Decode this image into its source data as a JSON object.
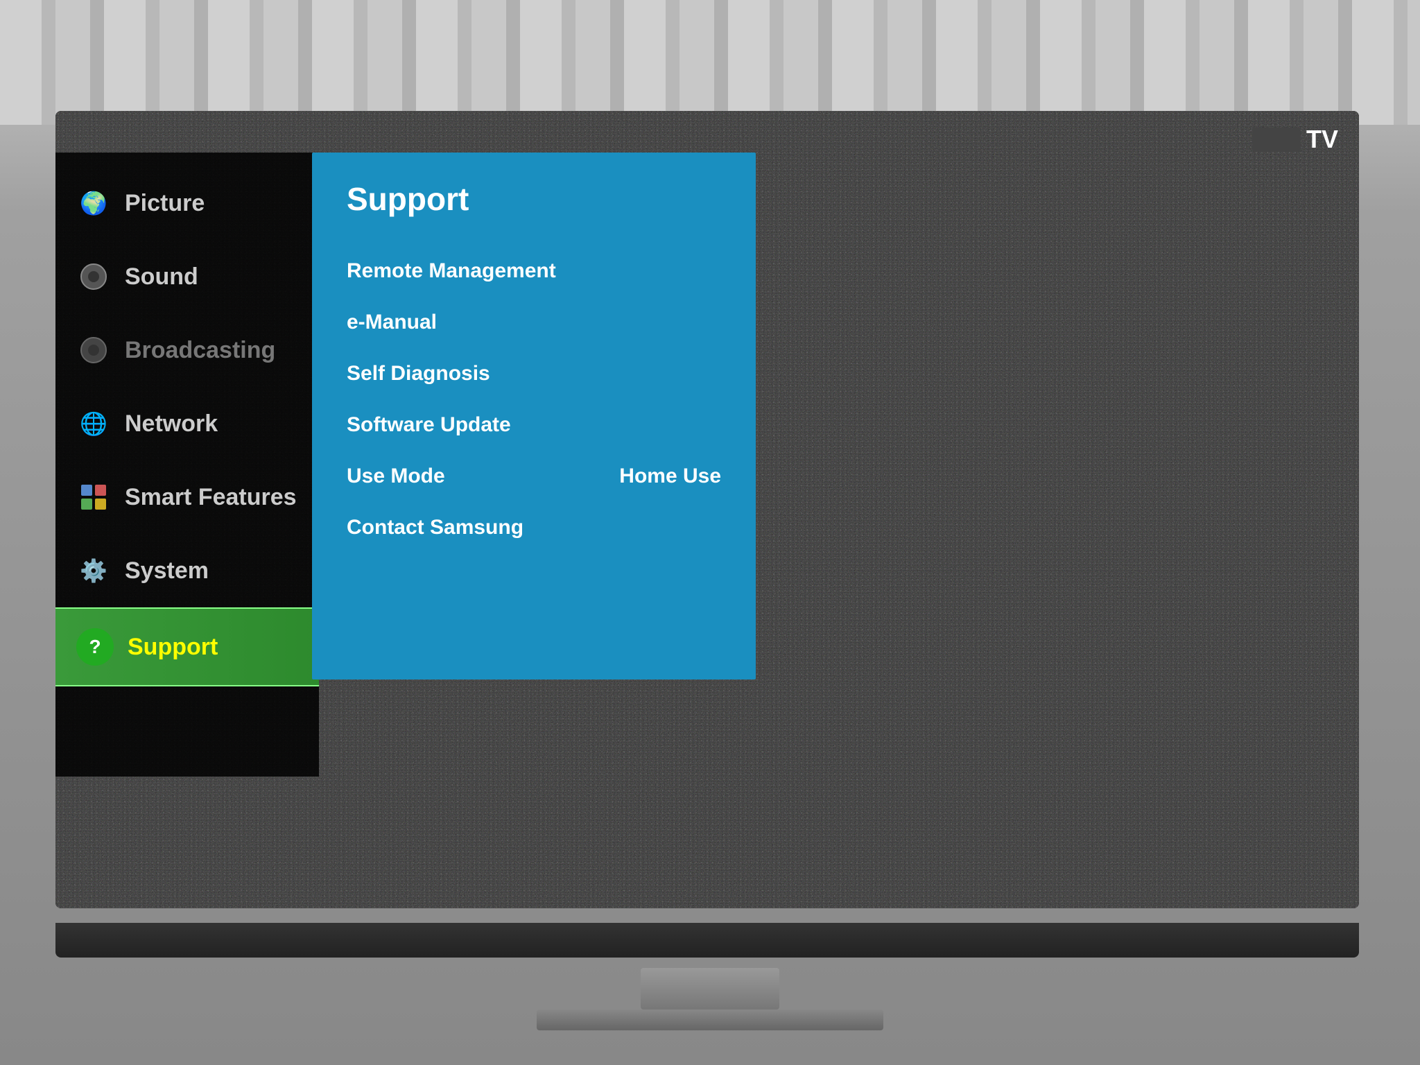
{
  "tv": {
    "label": "TV"
  },
  "sidebar": {
    "items": [
      {
        "id": "picture",
        "label": "Picture",
        "icon": "🌍",
        "state": "normal"
      },
      {
        "id": "sound",
        "label": "Sound",
        "icon": "⚫",
        "state": "normal"
      },
      {
        "id": "broadcasting",
        "label": "Broadcasting",
        "icon": "⚫",
        "state": "dim"
      },
      {
        "id": "network",
        "label": "Network",
        "icon": "🌐",
        "state": "normal"
      },
      {
        "id": "smart-features",
        "label": "Smart Features",
        "icon": "📦",
        "state": "normal"
      },
      {
        "id": "system",
        "label": "System",
        "icon": "⚙️",
        "state": "normal"
      },
      {
        "id": "support",
        "label": "Support",
        "icon": "?",
        "state": "active"
      }
    ]
  },
  "support_panel": {
    "title": "Support",
    "items": [
      {
        "id": "remote-management",
        "label": "Remote Management",
        "value": ""
      },
      {
        "id": "e-manual",
        "label": "e-Manual",
        "value": ""
      },
      {
        "id": "self-diagnosis",
        "label": "Self Diagnosis",
        "value": ""
      },
      {
        "id": "software-update",
        "label": "Software Update",
        "value": ""
      },
      {
        "id": "use-mode",
        "label": "Use Mode",
        "value": "Home Use"
      },
      {
        "id": "contact-samsung",
        "label": "Contact Samsung",
        "value": ""
      }
    ]
  }
}
